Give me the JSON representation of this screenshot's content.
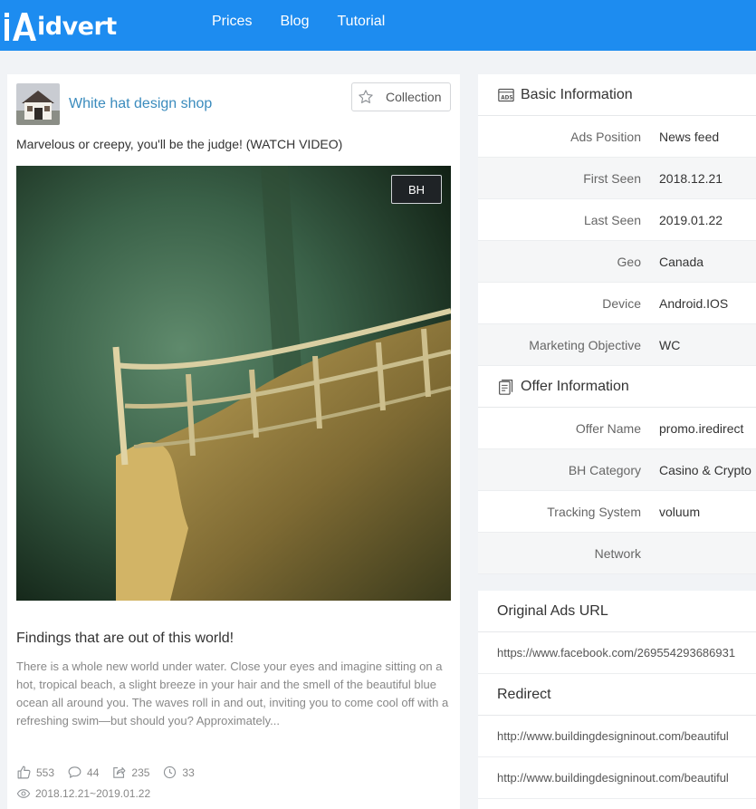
{
  "header": {
    "logo_text": "idvert",
    "logo_letter": "A",
    "nav": [
      "Prices",
      "Blog",
      "Tutorial"
    ]
  },
  "ad": {
    "shop_name": "White hat design shop",
    "collection_label": "Collection",
    "title": "Marvelous or creepy, you'll be the judge! (WATCH VIDEO)",
    "badge": "BH",
    "headline": "Findings that are out of this world!",
    "body": "There is a whole new world under water. Close your eyes and imagine sitting on a hot, tropical beach, a slight breeze in your hair and the smell of the beautiful blue ocean all around you. The waves roll in and out, inviting you to come cool off with a refreshing swim—but should you? Approximately...",
    "stats": {
      "likes": "553",
      "comments": "44",
      "shares": "235",
      "views": "33"
    },
    "date_range": "2018.12.21~2019.01.22"
  },
  "basic_info": {
    "title": "Basic Information",
    "rows": [
      {
        "label": "Ads Position",
        "value": "News feed"
      },
      {
        "label": "First Seen",
        "value": "2018.12.21"
      },
      {
        "label": "Last Seen",
        "value": "2019.01.22"
      },
      {
        "label": "Geo",
        "value": "Canada"
      },
      {
        "label": "Device",
        "value": "Android.IOS"
      },
      {
        "label": "Marketing Objective",
        "value": "WC"
      }
    ]
  },
  "offer_info": {
    "title": "Offer Information",
    "rows": [
      {
        "label": "Offer Name",
        "value": "promo.iredirect"
      },
      {
        "label": "BH Category",
        "value": "Casino & Crypto"
      },
      {
        "label": "Tracking System",
        "value": "voluum"
      },
      {
        "label": "Network",
        "value": ""
      }
    ]
  },
  "urls": {
    "original_title": "Original Ads URL",
    "original_url": "https://www.facebook.com/269554293686931",
    "redirect_title": "Redirect",
    "redirect_urls": [
      "http://www.buildingdesigninout.com/beautiful",
      "http://www.buildingdesigninout.com/beautiful"
    ]
  },
  "colors": {
    "header_bg": "#1d8cf0",
    "shop_link": "#3a8bbd"
  }
}
